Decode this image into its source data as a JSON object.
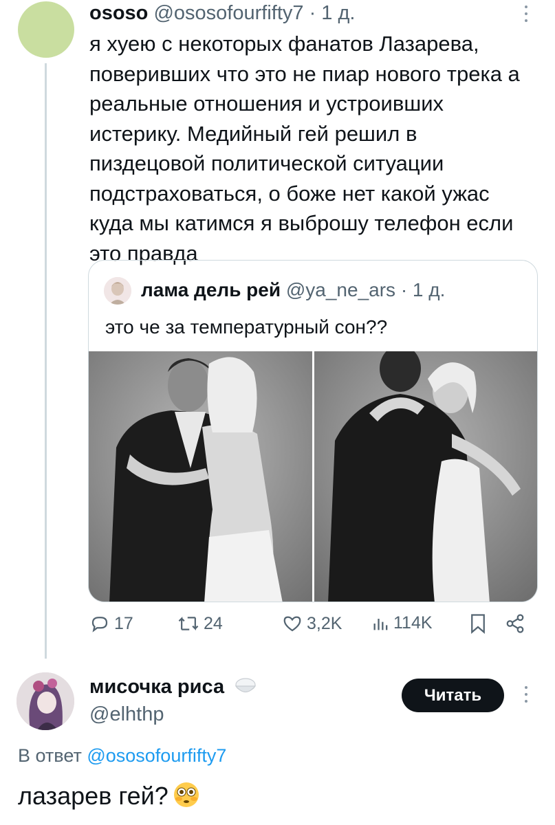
{
  "tweet": {
    "name": "ososo",
    "handle": "@ososofourfifty7",
    "time": "· 1 д.",
    "text": "я хуею с некоторых фанатов Лазарева, поверивших что это не пиар нового трека а реальные отношения и устроивших истерику. Медийный гей решил в пиздецовой политической ситуации подстраховаться, о боже нет какой ужас куда мы катимся я выброшу телефон если это правда",
    "more_icon": "more-vertical-icon"
  },
  "quote": {
    "name": "лама дель рей",
    "handle": "@ya_ne_ars",
    "time": "· 1 д.",
    "text": "это че за температурный сон??",
    "images": [
      "photo-couple-back-view",
      "photo-couple-front-view"
    ]
  },
  "actions": {
    "replies": "17",
    "retweets": "24",
    "likes": "3,2K",
    "views": "114K",
    "icons": [
      "reply-icon",
      "retweet-icon",
      "like-icon",
      "views-icon",
      "bookmark-icon",
      "share-icon"
    ]
  },
  "reply": {
    "name": "мисочка риса",
    "handle": "@elhthp",
    "follow_label": "Читать",
    "reply_prefix": "В ответ",
    "reply_to": "@ososofourfifty7",
    "text": "лазарев гей?",
    "emoji": "flushed-face-emoji"
  },
  "colors": {
    "text": "#0f1419",
    "secondary": "#536471",
    "link": "#1d9bf0",
    "avatar": "#c9dea0",
    "button": "#0f1419"
  }
}
